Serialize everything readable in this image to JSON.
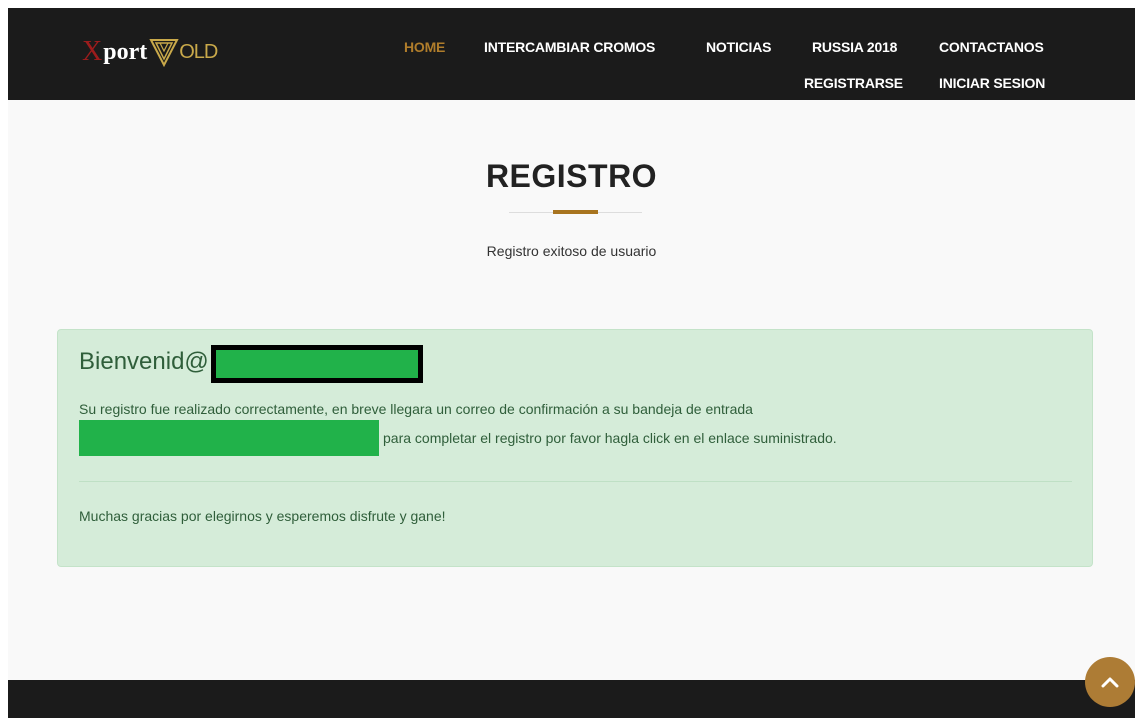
{
  "brand": {
    "prefix": "X",
    "name": "port",
    "suffix": "OLD"
  },
  "nav": {
    "items": [
      {
        "label": "HOME",
        "active": true
      },
      {
        "label": "INTERCAMBIAR CROMOS"
      },
      {
        "label": "NOTICIAS"
      },
      {
        "label": "RUSSIA 2018"
      },
      {
        "label": "CONTACTANOS"
      },
      {
        "label": "REGISTRARSE"
      },
      {
        "label": "INICIAR SESION"
      }
    ]
  },
  "main": {
    "title": "REGISTRO",
    "subtitle": "Registro exitoso de usuario"
  },
  "alert": {
    "heading": "Bienvenid@",
    "line1": "Su registro fue realizado correctamente, en breve llegara un correo de confirmación a su bandeja de entrada",
    "line2": "para completar el registro por favor hagla click en el enlace suministrado.",
    "footer": "Muchas gracias por elegirnos y esperemos disfrute y gane!"
  },
  "colors": {
    "accent": "#a8741f",
    "header_bg": "#1b1b1b",
    "alert_bg": "#d5ecd9",
    "redaction": "#21b24a"
  },
  "icons": {
    "scroll_top": "chevron-up-icon",
    "logo_mark": "triangle-v-icon"
  }
}
